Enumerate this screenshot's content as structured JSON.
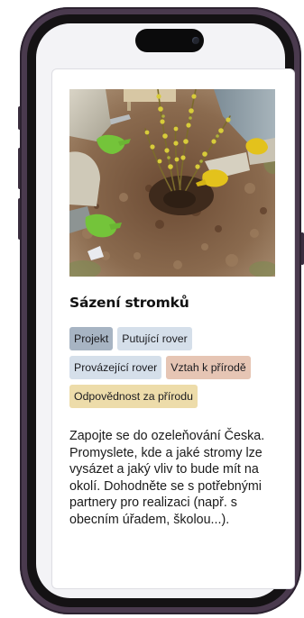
{
  "card": {
    "title": "Sázení stromků",
    "image_subject": "people-planting-young-tree",
    "tags": [
      {
        "label": "Projekt",
        "color": "#a7b4c3"
      },
      {
        "label": "Putující rover",
        "color": "#d5dfea"
      },
      {
        "label": "Provázející rover",
        "color": "#d5dfea"
      },
      {
        "label": "Vztah k přírodě",
        "color": "#e6c5b4"
      },
      {
        "label": "Odpovědnost za přírodu",
        "color": "#eddcaa"
      }
    ],
    "description": "Zapojte se do ozeleňování Česka. Promyslete, kde a jaké stromy lze vysázet a jaký vliv to bude mít na okolí. Dohodněte se s potřebnými partnery pro realizaci (např. s obecním úřadem, školou...)."
  },
  "colors": {
    "frame": "#4a3a4e",
    "screen": "#f3f3f6",
    "card": "#ffffff",
    "glove_green": "#74c43a",
    "glove_yellow": "#e3c21c"
  }
}
